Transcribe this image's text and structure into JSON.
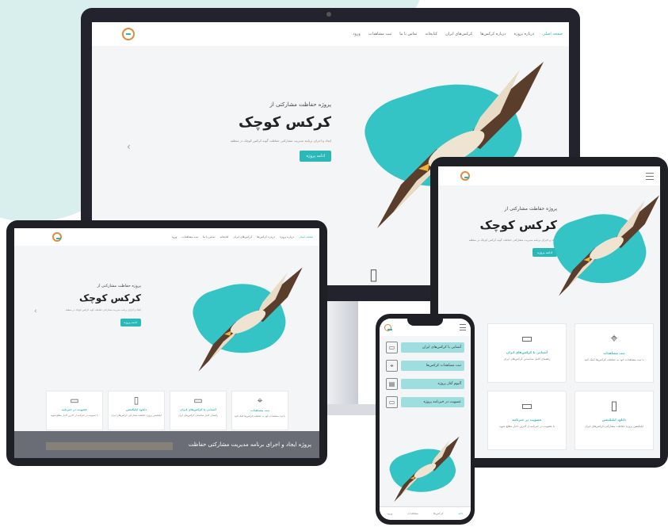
{
  "brand": {
    "accent": "#2bb8b8",
    "logo_color": "#e08a3b"
  },
  "nav": {
    "items": [
      "صفحه اصلی",
      "درباره پروژه",
      "درباره کرکس‌ها",
      "کرکس‌های ایران",
      "کتابخانه",
      "تماس با ما",
      "ثبت مشاهدات",
      "ورود"
    ]
  },
  "hero": {
    "subtitle": "پروژه حفاظت مشارکتی از",
    "title": "کرکس کوچک",
    "description": "ایجاد و اجرای برنامه مدیریت مشارکتی حفاظت گونه کرکس کوچک در منطقه",
    "cta": "ادامه پروژه"
  },
  "cards": [
    {
      "icon": "map-pin-icon",
      "title": "ثبت مشاهدات",
      "desc": "با ثبت مشاهدات خود به حفاظت کرکس‌ها کمک کنید"
    },
    {
      "icon": "book-icon",
      "title": "آشنایی با کرکس‌های ایران",
      "desc": "راهنمای کامل شناسایی کرکس‌های ایران"
    },
    {
      "icon": "phone-icon",
      "title": "دانلود اپلیکیشن",
      "desc": "اپلیکیشن پروژه حفاظت مشارکتی کرکس‌های ایران"
    },
    {
      "icon": "laptop-icon",
      "title": "عضویت در خبرنامه",
      "desc": "با عضویت در خبرنامه از آخرین اخبار مطلع شوید"
    }
  ],
  "laptop_footer": "پروژه ایجاد و اجرای برنامه مدیریت مشارکتی حفاظت",
  "phone": {
    "menu": [
      "آشنایی با کرکس‌های ایران",
      "ثبت مشاهدات کرکس‌ها",
      "آلبوم آغاز پروژه",
      "عضویت در خبرنامه پروژه"
    ],
    "tabs": [
      "خانه",
      "کرکس‌ها",
      "مشاهدات",
      "ورود"
    ]
  },
  "icons": {
    "prev": "chevron-left-icon",
    "next": "chevron-right-icon",
    "menu": "hamburger-icon"
  }
}
